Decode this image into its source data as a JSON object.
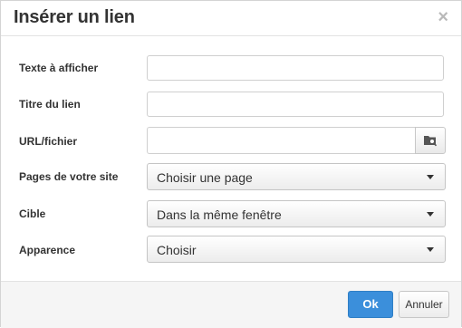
{
  "dialog": {
    "title": "Insérer un lien",
    "close_glyph": "×"
  },
  "fields": {
    "text_label": "Texte à afficher",
    "text_value": "",
    "title_label": "Titre du lien",
    "title_value": "",
    "url_label": "URL/fichier",
    "url_value": "",
    "url_browse_icon": "folder-search-icon",
    "pages_label": "Pages de votre site",
    "pages_selected": "Choisir une page",
    "target_label": "Cible",
    "target_selected": "Dans la même fenêtre",
    "appearance_label": "Apparence",
    "appearance_selected": "Choisir"
  },
  "footer": {
    "ok_label": "Ok",
    "cancel_label": "Annuler"
  },
  "colors": {
    "primary": "#3b8fdb"
  }
}
